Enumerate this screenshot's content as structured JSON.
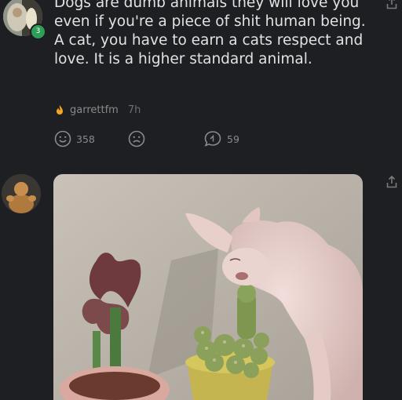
{
  "post": {
    "text": "Dogs are dumb animals they will love you even if you're a piece of shit human being. A cat, you have to earn a cats respect and love. It is a higher standard animal.",
    "author_badge_icon": "flame-icon",
    "author": "garrettfm",
    "time": "7h",
    "reactions": {
      "happy_count": "358",
      "sad_count": "",
      "reply_count": "59"
    }
  },
  "user_badge": "3",
  "icons": [
    "smiley-icon",
    "sad-face-icon",
    "reply-bubble-icon",
    "share-icon",
    "flame-icon"
  ],
  "colors": {
    "background": "#1e1f23",
    "text": "#e2e2e2",
    "meta": "#8a8a8a",
    "badge_green": "#2f9e56",
    "flame": "#f5a623"
  }
}
